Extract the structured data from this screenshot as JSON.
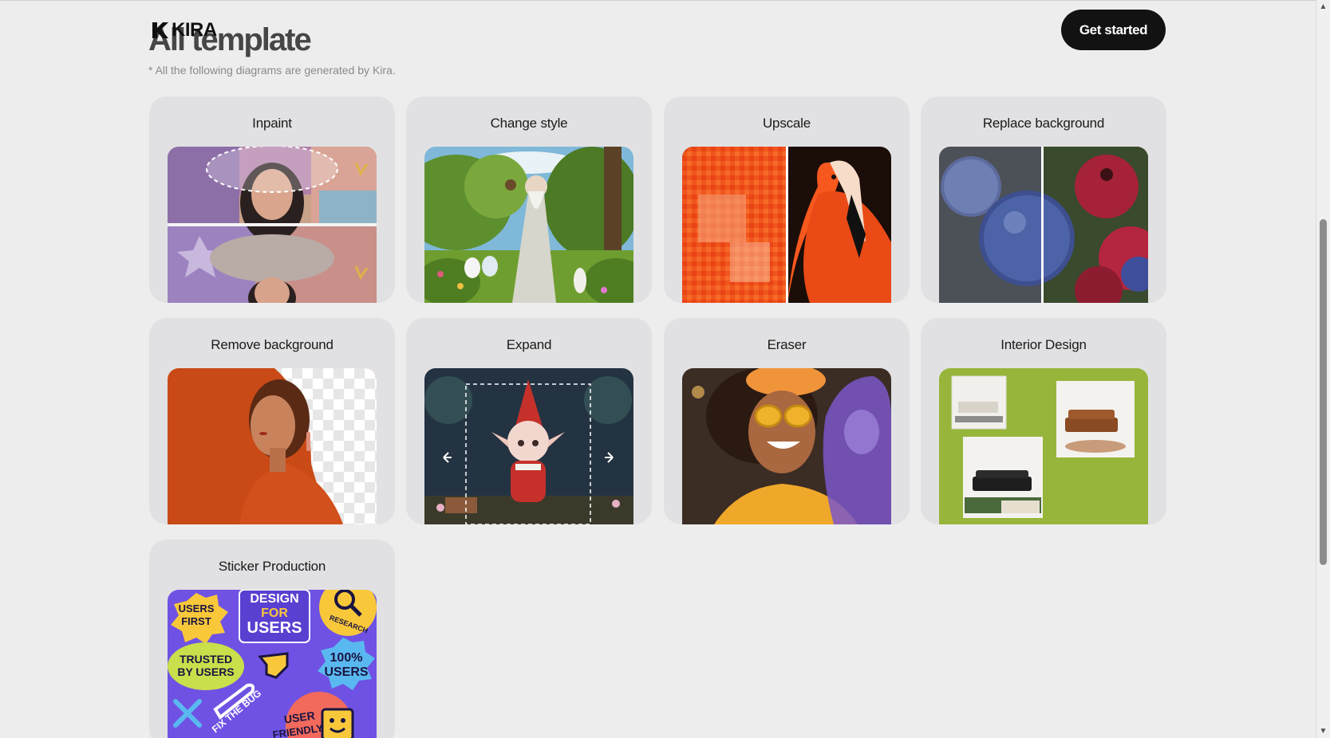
{
  "header": {
    "logo_text": "KIRA",
    "title": "All template",
    "subtitle": "* All the following diagrams are generated by Kira.",
    "cta_label": "Get started"
  },
  "templates": [
    {
      "label": "Inpaint"
    },
    {
      "label": "Change style"
    },
    {
      "label": "Upscale"
    },
    {
      "label": "Replace background"
    },
    {
      "label": "Remove background"
    },
    {
      "label": "Expand"
    },
    {
      "label": "Eraser"
    },
    {
      "label": "Interior Design"
    },
    {
      "label": "Sticker Production"
    }
  ],
  "stickers": {
    "users_first": "USERS FIRST",
    "design_for_users": "DESIGN FOR USERS",
    "research": "RESEARCH",
    "trusted": "TRUSTED BY USERS",
    "percent": "100% USERS",
    "fix_the_bug": "FIX THE BUG",
    "user_friendly": "USER FRIENDLY"
  },
  "colors": {
    "background": "#ededee",
    "card": "#e1e1e3",
    "cta": "#121212",
    "interior_green": "#97b53a",
    "sticker_purple": "#6f52e3"
  }
}
